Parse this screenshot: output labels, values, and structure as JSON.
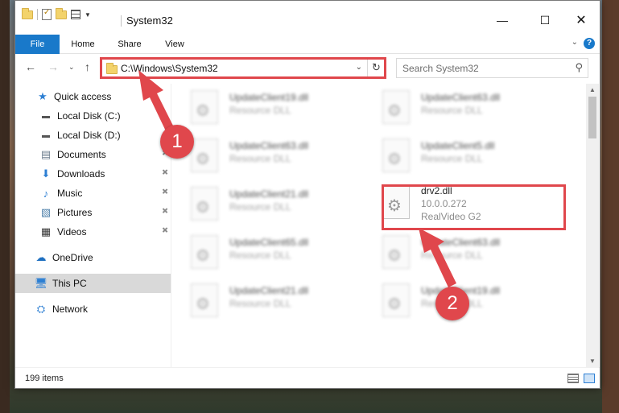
{
  "window": {
    "title": "System32"
  },
  "ribbon": {
    "tabs": [
      "File",
      "Home",
      "Share",
      "View"
    ]
  },
  "nav": {
    "address_path": "C:\\Windows\\System32",
    "search_placeholder": "Search System32"
  },
  "sidebar": {
    "items": [
      {
        "label": "Quick access",
        "icon": "star-icon",
        "pinned": false
      },
      {
        "label": "Local Disk (C:)",
        "icon": "drive-icon",
        "pinned": false
      },
      {
        "label": "Local Disk (D:)",
        "icon": "drive-icon",
        "pinned": false
      },
      {
        "label": "Documents",
        "icon": "documents-icon",
        "pinned": true
      },
      {
        "label": "Downloads",
        "icon": "download-icon",
        "pinned": true
      },
      {
        "label": "Music",
        "icon": "music-icon",
        "pinned": true
      },
      {
        "label": "Pictures",
        "icon": "pictures-icon",
        "pinned": true
      },
      {
        "label": "Videos",
        "icon": "videos-icon",
        "pinned": true
      },
      {
        "label": "OneDrive",
        "icon": "cloud-icon",
        "pinned": false
      },
      {
        "label": "This PC",
        "icon": "computer-icon",
        "pinned": false,
        "selected": true
      },
      {
        "label": "Network",
        "icon": "network-icon",
        "pinned": false
      }
    ]
  },
  "files": [
    {
      "name": "UpdateClient19.dll",
      "desc": "Resource DLL",
      "blurred": true
    },
    {
      "name": "UpdateClient63.dll",
      "desc": "Resource DLL",
      "blurred": true
    },
    {
      "name": "UpdateClient63.dll",
      "desc": "Resource DLL",
      "blurred": true
    },
    {
      "name": "UpdateClient5.dll",
      "desc": "Resource DLL",
      "blurred": true
    },
    {
      "name": "UpdateClient21.dll",
      "desc": "Resource DLL",
      "blurred": true
    },
    {
      "name": "drv2.dll",
      "version": "10.0.0.272",
      "desc": "RealVideo G2",
      "blurred": false,
      "highlighted": true
    },
    {
      "name": "UpdateClient65.dll",
      "desc": "Resource DLL",
      "blurred": true
    },
    {
      "name": "UpdateClient63.dll",
      "desc": "Resource DLL",
      "blurred": true
    },
    {
      "name": "UpdateClient21.dll",
      "desc": "Resource DLL",
      "blurred": true
    },
    {
      "name": "UpdateClient19.dll",
      "desc": "Resource DLL",
      "blurred": true
    }
  ],
  "status": {
    "item_count": "199 items"
  },
  "callouts": [
    {
      "number": "1"
    },
    {
      "number": "2"
    }
  ],
  "colors": {
    "accent": "#1979ca",
    "callout": "#e0474c",
    "selected_nav": "#d9d9d9"
  }
}
